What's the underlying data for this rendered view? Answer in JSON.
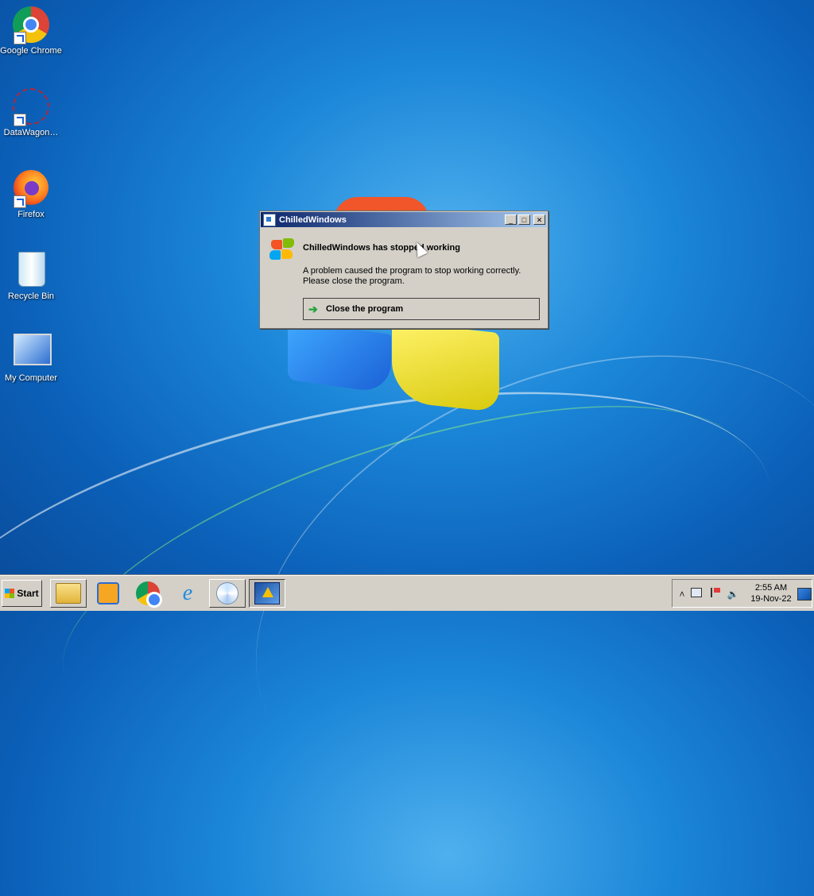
{
  "desktop": {
    "icons": [
      {
        "label": "Google Chrome",
        "icon": "chrome-icon"
      },
      {
        "label": "DataWagon…",
        "icon": "datawagon-icon"
      },
      {
        "label": "Firefox",
        "icon": "firefox-icon"
      },
      {
        "label": "Recycle Bin",
        "icon": "recycle-bin-icon"
      },
      {
        "label": "My Computer",
        "icon": "my-computer-icon"
      }
    ]
  },
  "dialog": {
    "title": "ChilledWindows",
    "heading": "ChilledWindows has stopped working",
    "message_line1": "A problem caused the program to stop working correctly.",
    "message_line2": "Please close the program.",
    "close_program_label": "Close the program",
    "minimize_glyph": "_",
    "maximize_glyph": "□",
    "close_glyph": "✕"
  },
  "taskbar": {
    "start_label": "Start",
    "buttons": [
      {
        "name": "file-explorer",
        "icon": "folder-icon"
      },
      {
        "name": "media-player",
        "icon": "media-player-icon"
      },
      {
        "name": "chrome",
        "icon": "chrome-icon"
      },
      {
        "name": "internet-explorer",
        "icon": "ie-icon"
      },
      {
        "name": "media-center",
        "icon": "cd-icon"
      },
      {
        "name": "chilledwindows",
        "icon": "warning-app-icon",
        "active": true
      }
    ],
    "tray": {
      "chevron": "˄",
      "time": "2:55 AM",
      "date": "19-Nov-22"
    }
  },
  "colors": {
    "titlebar_start": "#0a246a",
    "titlebar_end": "#a6caf0",
    "dialog_bg": "#d4d0c8",
    "arrow_green": "#1fa33a"
  }
}
